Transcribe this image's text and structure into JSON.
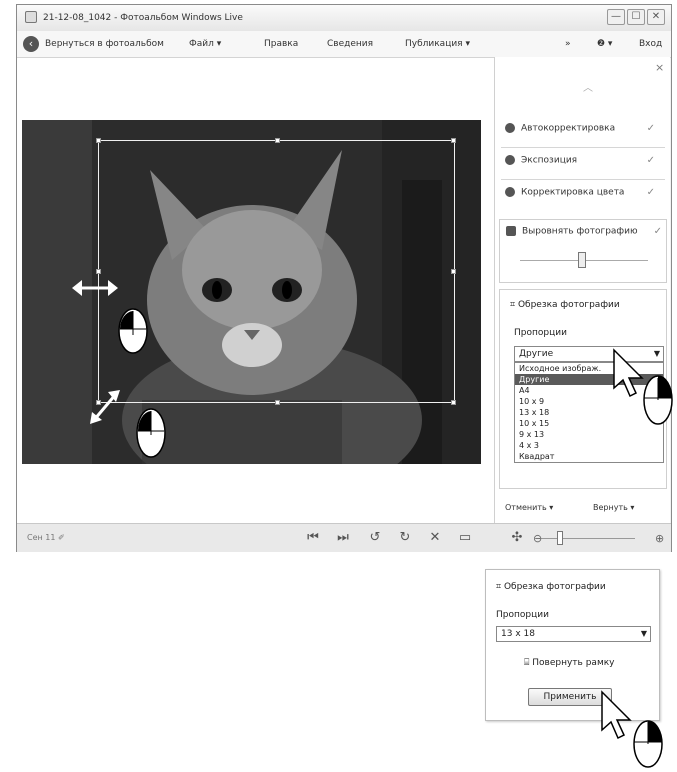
{
  "window": {
    "title": "21-12-08_1042 - Фотоальбом Windows Live",
    "buttons": {
      "minimize": "—",
      "maximize": "☐",
      "close": "✕"
    }
  },
  "menubar": {
    "back_label": "Вернуться в фотоальбом",
    "items": [
      "Файл ▾",
      "Правка",
      "Сведения",
      "Публикация ▾"
    ],
    "right": {
      "overflow": "»",
      "help": "❷ ▾",
      "signin": "Вход"
    }
  },
  "pane": {
    "close": "×",
    "up": "︿",
    "items": [
      {
        "label": "Автокорректировка",
        "icon": "wand-icon",
        "check": "✓"
      },
      {
        "label": "Экспозиция",
        "icon": "contrast-icon",
        "check": "✓"
      },
      {
        "label": "Корректировка цвета",
        "icon": "color-icon",
        "check": "✓"
      },
      {
        "label": "Выровнять фотографию",
        "icon": "straighten-icon",
        "check": "✓"
      }
    ],
    "crop": {
      "title": "Обрезка фотографии",
      "proportions_label": "Пропорции",
      "selected": "Другие",
      "options": [
        "Исходное изображ.",
        "Другие",
        "A4",
        "10 x 9",
        "13 x 18",
        "10 x 15",
        "9 x 13",
        "4 x 3",
        "Квадрат"
      ],
      "highlighted_index": 1
    },
    "bottom": {
      "undo": "Отменить ▾",
      "revert": "Вернуть ▾"
    }
  },
  "statusbar": {
    "text": "Сен 11 ✐",
    "controls": [
      "⏮",
      "⏭",
      "↺",
      "↻",
      "✕",
      "▭",
      "✣"
    ]
  },
  "inset": {
    "title": "Обрезка фотографии",
    "proportions_label": "Пропорции",
    "selected": "13 x 18",
    "rotate_frame": "Повернуть рамку",
    "apply": "Применить"
  }
}
